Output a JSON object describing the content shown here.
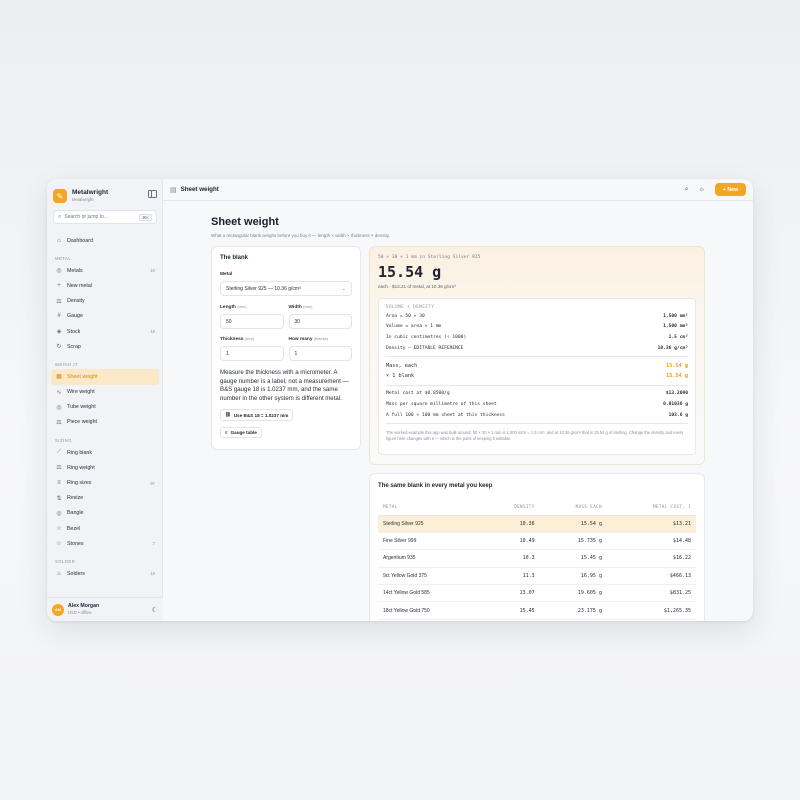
{
  "app": {
    "name": "Metalwright",
    "sub": "Metalwright"
  },
  "search": {
    "placeholder": "Search or jump to…",
    "shortcut": "⌘K"
  },
  "nav": {
    "top": [
      {
        "label": "Dashboard",
        "icon": "home-icon",
        "glyph": "⌂"
      }
    ],
    "sections": [
      {
        "title": "Metal",
        "items": [
          {
            "label": "Metals",
            "count": "10",
            "glyph": "◎",
            "icon": "coin-icon"
          },
          {
            "label": "New metal",
            "count": "",
            "glyph": "+",
            "icon": "plus-icon"
          },
          {
            "label": "Density",
            "count": "",
            "glyph": "⚖",
            "icon": "scale-icon"
          },
          {
            "label": "Gauge",
            "count": "",
            "glyph": "#",
            "icon": "hash-icon"
          },
          {
            "label": "Stock",
            "count": "16",
            "glyph": "◈",
            "icon": "layers-icon"
          },
          {
            "label": "Scrap",
            "count": "",
            "glyph": "↻",
            "icon": "recycle-icon"
          }
        ]
      },
      {
        "title": "Weigh it",
        "items": [
          {
            "label": "Sheet weight",
            "count": "",
            "glyph": "▦",
            "icon": "grid-icon",
            "active": true
          },
          {
            "label": "Wire weight",
            "count": "",
            "glyph": "∿",
            "icon": "wave-icon"
          },
          {
            "label": "Tube weight",
            "count": "",
            "glyph": "◎",
            "icon": "tube-icon"
          },
          {
            "label": "Piece weight",
            "count": "",
            "glyph": "⚖",
            "icon": "scale-icon"
          }
        ]
      },
      {
        "title": "Sizing",
        "items": [
          {
            "label": "Ring blank",
            "count": "",
            "glyph": "⟋",
            "icon": "ruler-icon"
          },
          {
            "label": "Ring weight",
            "count": "",
            "glyph": "⚖",
            "icon": "scale-icon"
          },
          {
            "label": "Ring sizes",
            "count": "97",
            "glyph": "≡",
            "icon": "list-icon"
          },
          {
            "label": "Resize",
            "count": "",
            "glyph": "⇅",
            "icon": "sliders-icon"
          },
          {
            "label": "Bangle",
            "count": "",
            "glyph": "◎",
            "icon": "circle-icon"
          },
          {
            "label": "Bezel",
            "count": "",
            "glyph": "☆",
            "icon": "star-icon"
          },
          {
            "label": "Stones",
            "count": "7",
            "glyph": "☆",
            "icon": "gem-icon"
          }
        ]
      },
      {
        "title": "Solder",
        "items": [
          {
            "label": "Solders",
            "count": "10",
            "glyph": "♨",
            "icon": "flame-icon"
          }
        ]
      }
    ]
  },
  "user": {
    "initials": "AM",
    "name": "Alex Morgan",
    "sub": "USD • offline"
  },
  "topbar": {
    "title": "Sheet weight",
    "new_label": "+ New"
  },
  "page": {
    "title": "Sheet weight",
    "lead": "What a rectangular blank weighs before you buy it — length × width × thickness × density."
  },
  "blank": {
    "title": "The blank",
    "metal_label": "Metal",
    "metal_value": "Sterling Silver 925 — 10.36 g/cm³",
    "length_label": "Length",
    "length_unit": "(mm)",
    "length_value": "50",
    "width_label": "Width",
    "width_unit": "(mm)",
    "width_value": "30",
    "thickness_label": "Thickness",
    "thickness_unit": "(mm)",
    "thickness_value": "1",
    "howmany_label": "How many",
    "howmany_unit": "(blanks)",
    "howmany_value": "1",
    "note": "Measure the thickness with a micrometer. A gauge number is a label, not a measurement — B&S gauge 18 is 1.0237 mm, and the same number in the other system is different metal.",
    "chip1": "Use B&S 18 = 1.0237 mm",
    "chip2": "Gauge table"
  },
  "result": {
    "sub": "50 × 30 × 1 mm in Sterling Silver 925",
    "big": "15.54 g",
    "each": "each · $13.21 of metal, at 10.36 g/cm³",
    "vd_head": "VOLUME × DENSITY",
    "rows1": [
      {
        "k": "Area = 50 × 30",
        "v": "1,500 mm²"
      },
      {
        "k": "Volume = area × 1 mm",
        "v": "1,500 mm³"
      },
      {
        "k": "In cubic centimetres (÷ 1000)",
        "v": "1.5 cm³"
      },
      {
        "k": "Density — EDITABLE REFERENCE",
        "v": "10.36 g/cm³"
      }
    ],
    "rows2": [
      {
        "k": "Mass, each",
        "v": "15.54 g"
      },
      {
        "k": "× 1 blank",
        "v": "15.54 g"
      }
    ],
    "rows3": [
      {
        "k": "Metal cost at $0.8500/g",
        "v": "$13.2090"
      },
      {
        "k": "Mass per square millimetre of this sheet",
        "v": "0.01036 g"
      },
      {
        "k": "A full 100 × 100 mm sheet at this thickness",
        "v": "103.6 g"
      }
    ],
    "foot": "The worked example this app was built around: 50 × 30 × 1 mm is 1,500 mm³ = 1.5 cm³, and at 10.36 g/cm³ that is 15.54 g of sterling. Change the density and every figure here changes with it — which is the point of keeping it editable."
  },
  "table": {
    "title": "The same blank in every metal you keep",
    "headers": [
      "METAL",
      "DENSITY",
      "MASS EACH",
      "METAL COST, 1"
    ],
    "rows": [
      [
        "Sterling Silver 925",
        "10.36",
        "15.54 g",
        "$13.21"
      ],
      [
        "Fine Silver 999",
        "10.49",
        "15.735 g",
        "$14.48"
      ],
      [
        "Argentium 935",
        "10.3",
        "15.45 g",
        "$16.22"
      ],
      [
        "9ct Yellow Gold 375",
        "11.3",
        "16.95 g",
        "$466.13"
      ],
      [
        "14ct Yellow Gold 585",
        "13.07",
        "19.605 g",
        "$831.25"
      ],
      [
        "18ct Yellow Gold 750",
        "15.45",
        "23.175 g",
        "$1,265.35"
      ],
      [
        "",
        "",
        "",
        ""
      ]
    ]
  },
  "colors": {
    "accent": "#f5a524",
    "accent_text": "#e89a14"
  }
}
